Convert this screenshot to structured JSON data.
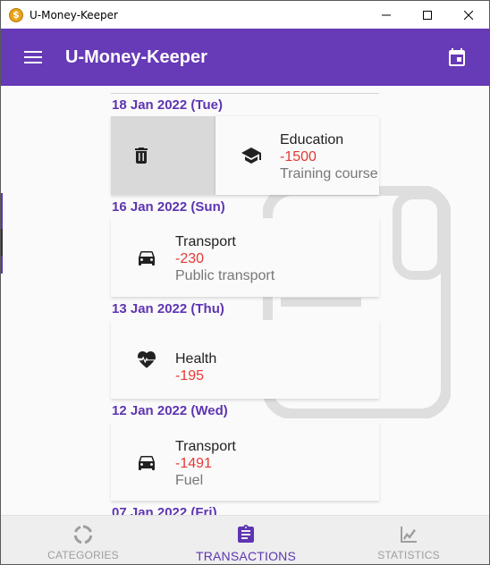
{
  "window": {
    "title": "U-Money-Keeper",
    "icon_letter": "$",
    "controls": [
      "minimize-icon",
      "maximize-icon",
      "close-icon"
    ]
  },
  "appbar": {
    "title": "U-Money-Keeper",
    "menu_icon": "menu-icon",
    "action_icon": "calendar-icon"
  },
  "colors": {
    "primary": "#673ab7",
    "accent": "#5e35b1",
    "negative": "#e53935",
    "secondary_text": "#777777"
  },
  "transactions": [
    {
      "date": "18 Jan 2022 (Tue)",
      "category": "Education",
      "amount": "-1500",
      "note": "Training course",
      "icon": "graduation-cap-icon",
      "swiped": true,
      "swipe_action_icon": "delete-icon"
    },
    {
      "date": "16 Jan 2022 (Sun)",
      "category": "Transport",
      "amount": "-230",
      "note": "Public transport",
      "icon": "car-icon"
    },
    {
      "date": "13 Jan 2022 (Thu)",
      "category": "Health",
      "amount": "-195",
      "note": "",
      "icon": "heartbeat-icon"
    },
    {
      "date": "12 Jan 2022 (Wed)",
      "category": "Transport",
      "amount": "-1491",
      "note": "Fuel",
      "icon": "car-icon"
    },
    {
      "date": "07 Jan 2022 (Fri)"
    }
  ],
  "bottom_nav": {
    "active": "TRANSACTIONS",
    "items": [
      {
        "label": "CATEGORIES",
        "icon": "categories-icon"
      },
      {
        "label": "TRANSACTIONS",
        "icon": "transactions-icon"
      },
      {
        "label": "STATISTICS",
        "icon": "statistics-icon"
      }
    ]
  }
}
